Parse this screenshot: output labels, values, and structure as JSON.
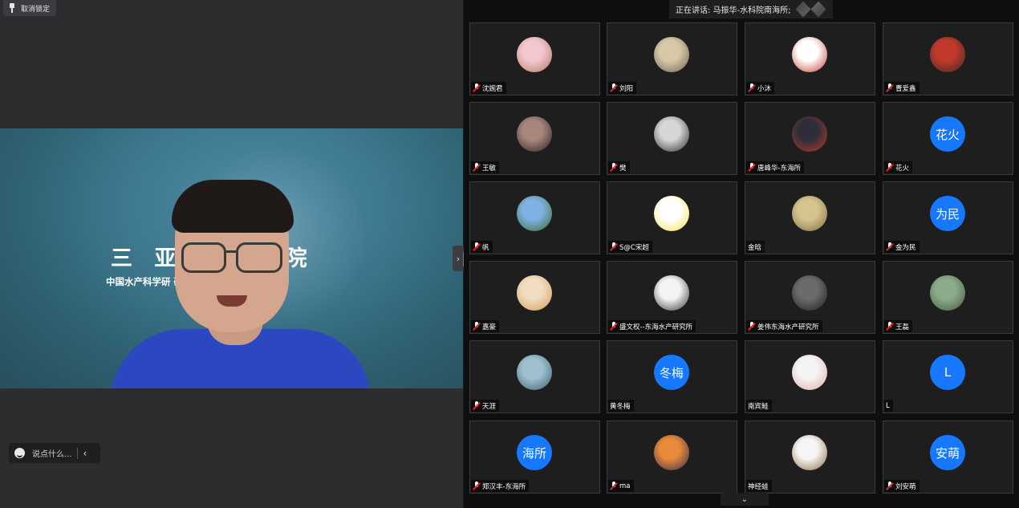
{
  "stage": {
    "unpin_label": "取消锁定",
    "banner_title": "三亚热带水产研究院",
    "banner_title_visible": "三 亚 热   究 院",
    "banner_subtitle_visible": "中国水产科学研          研究开发中心",
    "chat_placeholder": "说点什么..."
  },
  "gallery": {
    "speaking_label": "正在讲话: 马振华-水科院南海所;",
    "participants": [
      {
        "name": "沈婉君",
        "avatar": "photo",
        "colors": [
          "#f3c7cf",
          "#b07a62"
        ],
        "muted": true
      },
      {
        "name": "刘阳",
        "avatar": "photo",
        "colors": [
          "#d7c9a8",
          "#6a6355"
        ],
        "muted": true
      },
      {
        "name": "小沐",
        "avatar": "photo",
        "colors": [
          "#ffffff",
          "#c0392b"
        ],
        "muted": true
      },
      {
        "name": "曹爱鑫",
        "avatar": "photo",
        "colors": [
          "#c0392b",
          "#3b2b26"
        ],
        "muted": true
      },
      {
        "name": "王敏",
        "avatar": "photo",
        "colors": [
          "#a8857d",
          "#2b1f1f"
        ],
        "muted": true
      },
      {
        "name": "樊",
        "avatar": "photo",
        "colors": [
          "#d6d6d6",
          "#2a2a2a"
        ],
        "muted": true
      },
      {
        "name": "唐峰华-东海所",
        "avatar": "photo",
        "colors": [
          "#2e2e3a",
          "#c0392b"
        ],
        "muted": true
      },
      {
        "name": "花火",
        "avatar": "text",
        "avatar_text": "花火",
        "muted": true
      },
      {
        "name": "帆",
        "avatar": "photo",
        "colors": [
          "#7fb1e3",
          "#3c6b2b"
        ],
        "muted": true
      },
      {
        "name": "S@C宋超",
        "avatar": "photo",
        "colors": [
          "#ffffff",
          "#f7e34b"
        ],
        "muted": true
      },
      {
        "name": "金晗",
        "avatar": "photo",
        "colors": [
          "#d6c48f",
          "#7c6a3e"
        ],
        "muted": false
      },
      {
        "name": "金为民",
        "avatar": "text",
        "avatar_text": "为民",
        "muted": true
      },
      {
        "name": "嘉豪",
        "avatar": "photo",
        "colors": [
          "#f0dcc0",
          "#d49a55"
        ],
        "muted": true
      },
      {
        "name": "盛文权--东海水产研究所",
        "avatar": "photo",
        "colors": [
          "#f4f4f4",
          "#333333"
        ],
        "muted": true
      },
      {
        "name": "姜伟东海水产研究所",
        "avatar": "photo",
        "colors": [
          "#6b6b6b",
          "#1f1f1f"
        ],
        "muted": true
      },
      {
        "name": "王磊",
        "avatar": "photo",
        "colors": [
          "#8dab8a",
          "#3f5a3a"
        ],
        "muted": true
      },
      {
        "name": "天涯",
        "avatar": "photo",
        "colors": [
          "#9fc1cf",
          "#3c5f6e"
        ],
        "muted": true
      },
      {
        "name": "黄冬梅",
        "avatar": "text",
        "avatar_text": "冬梅",
        "muted": false
      },
      {
        "name": "南宾鲑",
        "avatar": "photo",
        "colors": [
          "#f4f4f4",
          "#e4a9a9"
        ],
        "muted": false
      },
      {
        "name": "L",
        "avatar": "text",
        "avatar_text": "L",
        "muted": false
      },
      {
        "name": "郑汉丰-东海所",
        "avatar": "text",
        "avatar_text": "海所",
        "muted": true
      },
      {
        "name": "ma",
        "avatar": "photo",
        "colors": [
          "#e98a3a",
          "#2b2b4a"
        ],
        "muted": true
      },
      {
        "name": "神经蛙",
        "avatar": "photo",
        "colors": [
          "#f5f5f5",
          "#8a6a3f"
        ],
        "muted": false
      },
      {
        "name": "刘安萌",
        "avatar": "text",
        "avatar_text": "安萌",
        "muted": true
      }
    ]
  },
  "colors": {
    "accent_blue": "#1677ff",
    "muted_red": "#e0252b",
    "shirt_blue": "#2c48c0"
  }
}
